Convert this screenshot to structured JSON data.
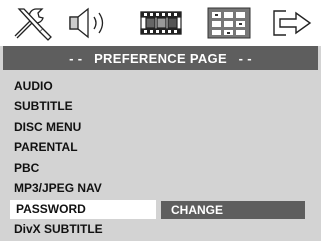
{
  "icon_bar": {
    "icons": [
      {
        "name": "settings-tools-icon",
        "selected": false
      },
      {
        "name": "speaker-audio-icon",
        "selected": false
      },
      {
        "name": "film-video-icon",
        "selected": false
      },
      {
        "name": "preference-grid-icon",
        "selected": true
      },
      {
        "name": "exit-arrow-icon",
        "selected": false
      }
    ]
  },
  "title": "- -   PREFERENCE PAGE   - -",
  "menu": {
    "items": [
      {
        "label": "AUDIO"
      },
      {
        "label": "SUBTITLE"
      },
      {
        "label": "DISC MENU"
      },
      {
        "label": "PARENTAL"
      },
      {
        "label": "PBC"
      },
      {
        "label": "MP3/JPEG NAV"
      },
      {
        "label": "PASSWORD",
        "selected": true
      },
      {
        "label": "DivX SUBTITLE"
      }
    ]
  },
  "submenu": {
    "option": "CHANGE"
  },
  "colors": {
    "background": "#d3d3d3",
    "title_bar": "#5e5e5e",
    "highlight": "#ffffff",
    "submenu_bg": "#5e5e5e",
    "text_dark": "#111111",
    "text_light": "#ffffff"
  }
}
